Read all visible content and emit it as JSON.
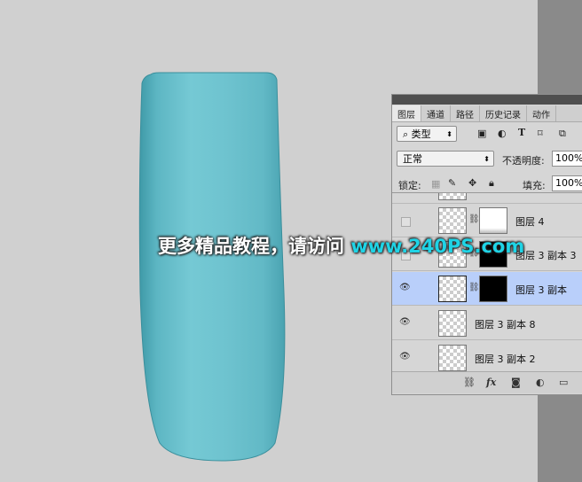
{
  "panel": {
    "tabs": [
      "图层",
      "通道",
      "路径",
      "历史记录",
      "动作"
    ],
    "filter_kind": "类型",
    "blend_mode": "正常",
    "opacity_label": "不透明度:",
    "opacity_value": "100%",
    "lock_label": "锁定:",
    "fill_label": "填充:",
    "fill_value": "100%",
    "layers": [
      {
        "name": "图层 4",
        "visible": false,
        "mask": "white"
      },
      {
        "name": "图层 3 副本 3",
        "visible": false,
        "mask": "black"
      },
      {
        "name": "图层 3 副本",
        "visible": true,
        "mask": "black",
        "selected": true
      },
      {
        "name": "图层 3 副本 8",
        "visible": true,
        "mask": null
      },
      {
        "name": "图层 3 副本 2",
        "visible": true,
        "mask": null
      }
    ],
    "footer_icons": [
      "link-icon",
      "fx-icon",
      "mask-icon",
      "adjustment-icon",
      "folder-icon"
    ],
    "fx_label": "fx"
  },
  "watermark": {
    "text": "更多精品教程，请访问",
    "url": "www.240PS.com"
  },
  "colors": {
    "cup": "#6ec3cf",
    "selected_layer": "#b9cffa"
  }
}
